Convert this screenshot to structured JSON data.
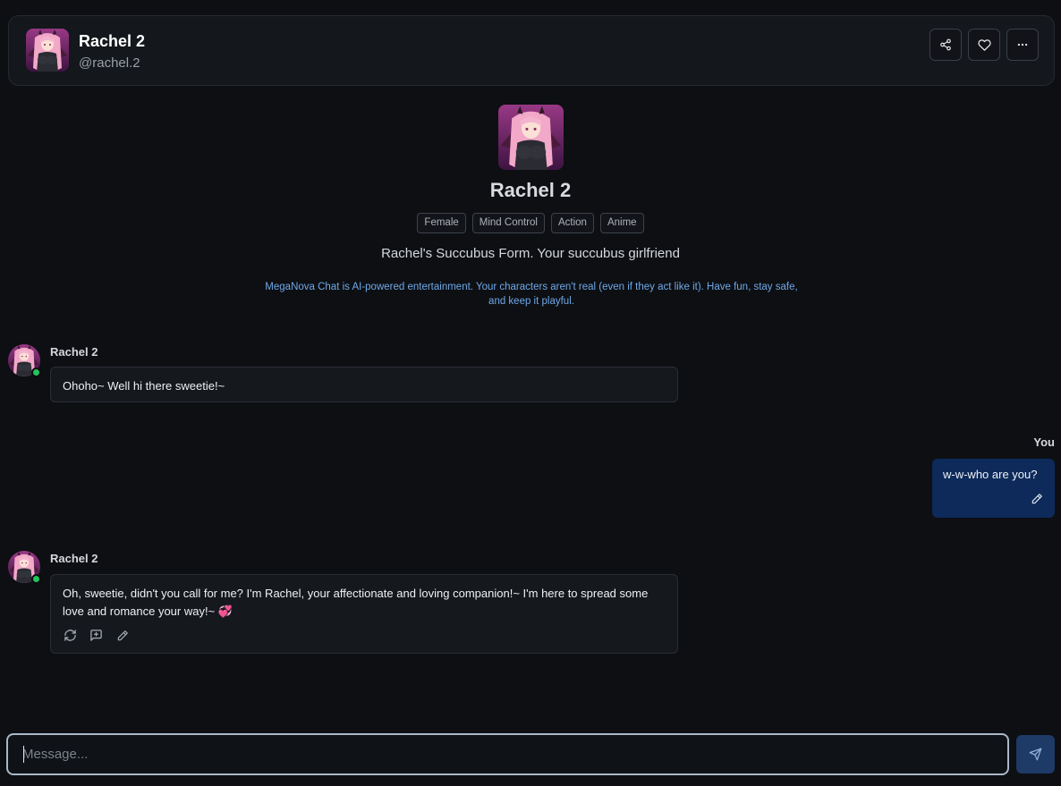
{
  "header": {
    "name": "Rachel 2",
    "handle": "@rachel.2",
    "buttons": {
      "share": "share-icon",
      "favorite": "heart-icon",
      "more": "more-horizontal-icon"
    }
  },
  "profile": {
    "name": "Rachel 2",
    "tags": [
      "Female",
      "Mind Control",
      "Action",
      "Anime"
    ],
    "tagline": "Rachel's Succubus Form. Your succubus girlfriend",
    "disclaimer": "MegaNova Chat is AI-powered entertainment. Your characters aren't real (even if they act like it). Have fun, stay safe, and keep it playful."
  },
  "messages": [
    {
      "sender": "Rachel 2",
      "role": "bot",
      "text": "Ohoho~ Well hi there sweetie!~"
    },
    {
      "sender": "You",
      "role": "user",
      "text": "w-w-who are you?"
    },
    {
      "sender": "Rachel 2",
      "role": "bot",
      "text": "Oh, sweetie, didn't you call for me? I'm Rachel, your affectionate and loving companion!~ I'm here to spread some love and romance your way!~ 💞"
    }
  ],
  "composer": {
    "placeholder": "Message...",
    "value": ""
  },
  "colors": {
    "background": "#0d0f13",
    "user_bubble": "#0d2a5a",
    "send_button": "#1e3a66",
    "online": "#22c55e",
    "disclaimer": "#6fa8e8"
  }
}
